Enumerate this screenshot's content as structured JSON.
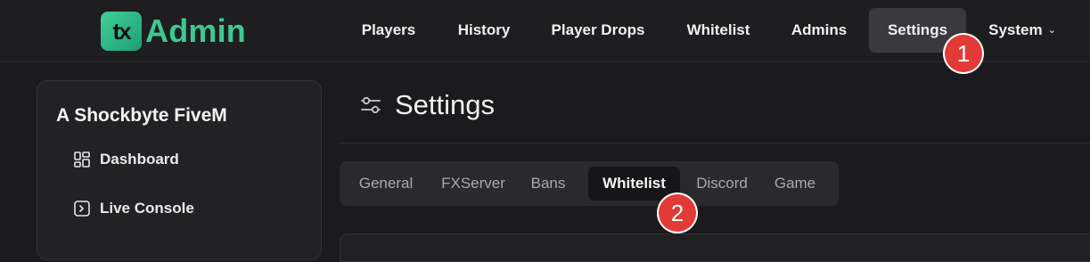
{
  "brand": {
    "badge": "tx",
    "name": "Admin",
    "accent": "#3fc791"
  },
  "nav": {
    "items": [
      {
        "label": "Players"
      },
      {
        "label": "History"
      },
      {
        "label": "Player Drops"
      },
      {
        "label": "Whitelist"
      },
      {
        "label": "Admins"
      },
      {
        "label": "Settings",
        "active": true
      },
      {
        "label": "System",
        "dropdown": true
      }
    ]
  },
  "callouts": {
    "one": "1",
    "two": "2",
    "color": "#e23a36"
  },
  "sidebar": {
    "server_name": "A Shockbyte FiveM",
    "items": [
      {
        "label": "Dashboard",
        "icon": "dashboard-icon"
      },
      {
        "label": "Live Console",
        "icon": "console-icon"
      }
    ]
  },
  "main": {
    "title": "Settings",
    "title_icon": "sliders-icon",
    "tabs": [
      {
        "label": "General"
      },
      {
        "label": "FXServer"
      },
      {
        "label": "Bans"
      },
      {
        "label": "Whitelist",
        "active": true
      },
      {
        "label": "Discord"
      },
      {
        "label": "Game"
      }
    ]
  }
}
